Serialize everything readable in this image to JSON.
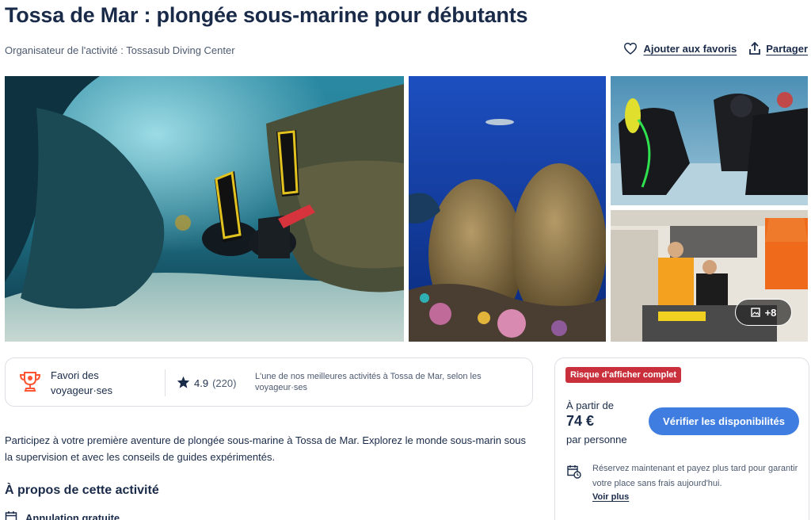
{
  "page": {
    "title": "Tossa de Mar : plongée sous-marine pour débutants",
    "organizer": "Organisateur de l'activité : Tossasub Diving Center"
  },
  "actions": {
    "favorites_label": "Ajouter aux favoris",
    "share_label": "Partager"
  },
  "gallery": {
    "more_label": "+8"
  },
  "highlights": {
    "favorite_label": "Favori des voyageur·ses",
    "rating": "4.9",
    "reviews": "(220)",
    "best_text": "L'une de nos meilleures activités à Tossa de Mar, selon les voyageur·ses"
  },
  "description": "Participez à votre première aventure de plongée sous-marine à Tossa de Mar. Explorez le monde sous-marin sous la supervision et avec les conseils de guides expérimentés.",
  "about": {
    "heading": "À propos de cette activité",
    "cancellation": "Annulation gratuite"
  },
  "booking": {
    "badge": "Risque d'afficher complet",
    "from_label": "À partir de",
    "price": "74 €",
    "per_person": "par personne",
    "cta_label": "Vérifier les disponibilités",
    "reserve_text": "Réservez maintenant et payez plus tard pour garantir votre place sans frais aujourd'hui.",
    "see_more": "Voir plus"
  },
  "colors": {
    "primary_text": "#1a2b49",
    "cta": "#3f7de0",
    "badge": "#c9303c",
    "accent_orange": "#ff5533"
  },
  "icons": [
    "heart-icon",
    "share-icon",
    "photo-icon",
    "trophy-icon",
    "star-icon",
    "calendar-clock-icon",
    "calendar-icon"
  ]
}
